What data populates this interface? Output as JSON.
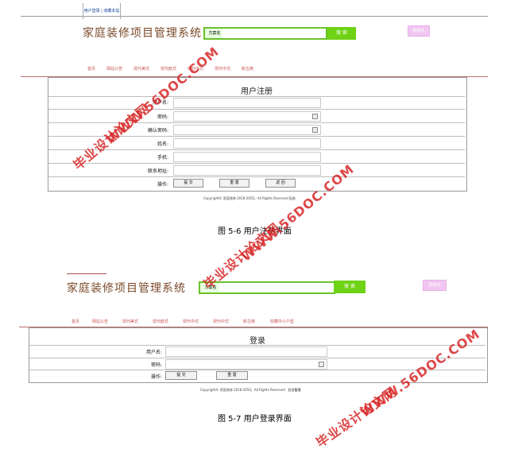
{
  "site": {
    "name": "家庭装修项目管理系统",
    "top_links": "用户登录 | 收藏本站",
    "search_label": "方案名",
    "search_button": "搜 索",
    "side_button": "购物车"
  },
  "nav_register": [
    "首页",
    "网站公告",
    "现代美式",
    "现代欧式",
    "现代中式",
    "现代中式",
    "新古典"
  ],
  "nav_login": [
    "首页",
    "网站公告",
    "现代美式",
    "现代欧式",
    "现代中式",
    "现代中式",
    "新古典",
    "收藏中小户型"
  ],
  "register_form": {
    "title": "用户注册",
    "fields": [
      {
        "label": "用户名:"
      },
      {
        "label": "密码:"
      },
      {
        "label": "确认密码:"
      },
      {
        "label": "姓名:"
      },
      {
        "label": "手机:"
      },
      {
        "label": "联系地址:"
      }
    ],
    "action_label": "操作:",
    "buttons": [
      "提 交",
      "重 置",
      "返 回"
    ],
    "copyright": "Copyright© 家庭装修 2018-2050。All Rights Reserved",
    "copyright_link": "后台"
  },
  "caption1": "图 5-6 用户注册界面",
  "login_form": {
    "title": "登录",
    "fields": [
      {
        "label": "用户名:"
      },
      {
        "label": "密码:"
      }
    ],
    "action_label": "操作:",
    "buttons": [
      "提 交",
      "重 置"
    ],
    "copyright": "Copyright© 家庭装修 2018-2050。All Rights Reserved",
    "copyright_link": "后台管理"
  },
  "caption2": "图 5-7 用户登录界面",
  "watermarks": {
    "cn": "毕业设计论文网",
    "en": "WWW.56DOC.COM"
  }
}
